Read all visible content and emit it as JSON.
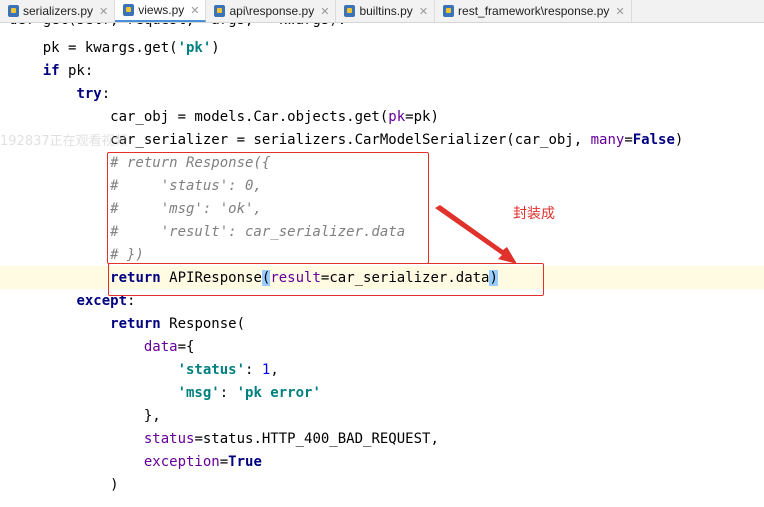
{
  "tabs": [
    {
      "label": "serializers.py",
      "active": false
    },
    {
      "label": "views.py",
      "active": true
    },
    {
      "label": "api\\response.py",
      "active": false
    },
    {
      "label": "builtins.py",
      "active": false
    },
    {
      "label": "rest_framework\\response.py",
      "active": false
    }
  ],
  "code": {
    "l0": "def get(self, request, *args, **kwargs):",
    "l1": {
      "a": "    pk = kwargs.get(",
      "b": "'pk'",
      "c": ")"
    },
    "l2": {
      "a": "    ",
      "b": "if",
      "c": " pk:"
    },
    "l3": {
      "a": "        ",
      "b": "try",
      "c": ":"
    },
    "l4": {
      "a": "            car_obj = models.Car.objects.get(",
      "b": "pk",
      "c": "=pk)"
    },
    "l5": {
      "a": "            car_serializer = serializers.CarModelSerializer(car_obj, ",
      "b": "many",
      "c": "=",
      "d": "False",
      "e": ")"
    },
    "l6": "            # return Response({",
    "l7": "            #     'status': 0,",
    "l8": "            #     'msg': 'ok',",
    "l9": "            #     'result': car_serializer.data",
    "l10": "            # })",
    "l11": {
      "a": "            ",
      "b": "return",
      "c": " APIResponse",
      "d": "(",
      "e": "result",
      "f": "=car_serializer.data",
      "g": ")"
    },
    "l12": {
      "a": "        ",
      "b": "except",
      "c": ":"
    },
    "l13": {
      "a": "            ",
      "b": "return",
      "c": " Response("
    },
    "l14": {
      "a": "                ",
      "b": "data",
      "c": "={"
    },
    "l15": {
      "a": "                    ",
      "b": "'status'",
      "c": ": ",
      "d": "1",
      "e": ","
    },
    "l16": {
      "a": "                    ",
      "b": "'msg'",
      "c": ": ",
      "d": "'pk error'"
    },
    "l17": "                },",
    "l18": {
      "a": "                ",
      "b": "status",
      "c": "=status.HTTP_400_BAD_REQUEST,"
    },
    "l19": {
      "a": "                ",
      "b": "exception",
      "c": "=",
      "d": "True"
    },
    "l20": "            )"
  },
  "annotation": "封装成",
  "watermark": "192837正在观看视频",
  "colors": {
    "accent_red": "#e0322b",
    "keyword": "#000080",
    "string": "#008080",
    "kwarg": "#660099",
    "comment": "#808080"
  }
}
